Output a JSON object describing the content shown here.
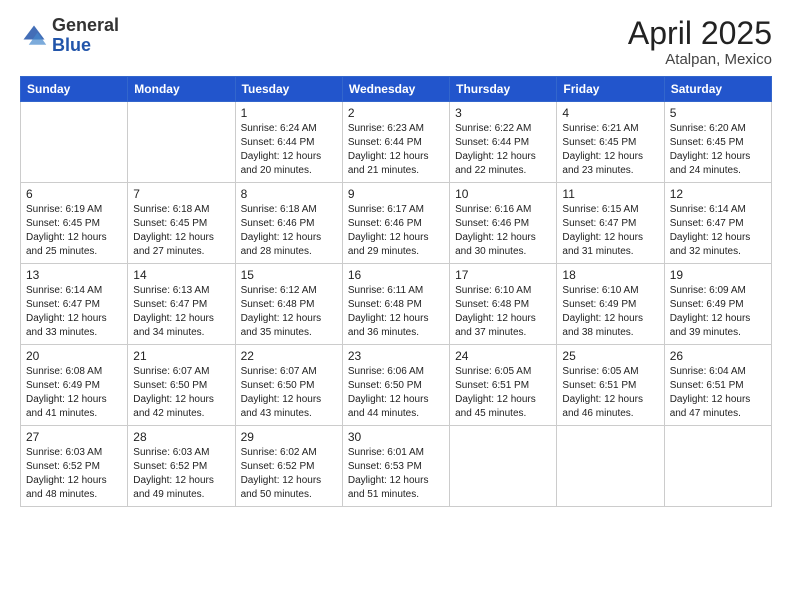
{
  "logo": {
    "general": "General",
    "blue": "Blue"
  },
  "title": {
    "month": "April 2025",
    "location": "Atalpan, Mexico"
  },
  "weekdays": [
    "Sunday",
    "Monday",
    "Tuesday",
    "Wednesday",
    "Thursday",
    "Friday",
    "Saturday"
  ],
  "weeks": [
    [
      {
        "day": null,
        "sunrise": null,
        "sunset": null,
        "daylight": null
      },
      {
        "day": null,
        "sunrise": null,
        "sunset": null,
        "daylight": null
      },
      {
        "day": "1",
        "sunrise": "Sunrise: 6:24 AM",
        "sunset": "Sunset: 6:44 PM",
        "daylight": "Daylight: 12 hours and 20 minutes."
      },
      {
        "day": "2",
        "sunrise": "Sunrise: 6:23 AM",
        "sunset": "Sunset: 6:44 PM",
        "daylight": "Daylight: 12 hours and 21 minutes."
      },
      {
        "day": "3",
        "sunrise": "Sunrise: 6:22 AM",
        "sunset": "Sunset: 6:44 PM",
        "daylight": "Daylight: 12 hours and 22 minutes."
      },
      {
        "day": "4",
        "sunrise": "Sunrise: 6:21 AM",
        "sunset": "Sunset: 6:45 PM",
        "daylight": "Daylight: 12 hours and 23 minutes."
      },
      {
        "day": "5",
        "sunrise": "Sunrise: 6:20 AM",
        "sunset": "Sunset: 6:45 PM",
        "daylight": "Daylight: 12 hours and 24 minutes."
      }
    ],
    [
      {
        "day": "6",
        "sunrise": "Sunrise: 6:19 AM",
        "sunset": "Sunset: 6:45 PM",
        "daylight": "Daylight: 12 hours and 25 minutes."
      },
      {
        "day": "7",
        "sunrise": "Sunrise: 6:18 AM",
        "sunset": "Sunset: 6:45 PM",
        "daylight": "Daylight: 12 hours and 27 minutes."
      },
      {
        "day": "8",
        "sunrise": "Sunrise: 6:18 AM",
        "sunset": "Sunset: 6:46 PM",
        "daylight": "Daylight: 12 hours and 28 minutes."
      },
      {
        "day": "9",
        "sunrise": "Sunrise: 6:17 AM",
        "sunset": "Sunset: 6:46 PM",
        "daylight": "Daylight: 12 hours and 29 minutes."
      },
      {
        "day": "10",
        "sunrise": "Sunrise: 6:16 AM",
        "sunset": "Sunset: 6:46 PM",
        "daylight": "Daylight: 12 hours and 30 minutes."
      },
      {
        "day": "11",
        "sunrise": "Sunrise: 6:15 AM",
        "sunset": "Sunset: 6:47 PM",
        "daylight": "Daylight: 12 hours and 31 minutes."
      },
      {
        "day": "12",
        "sunrise": "Sunrise: 6:14 AM",
        "sunset": "Sunset: 6:47 PM",
        "daylight": "Daylight: 12 hours and 32 minutes."
      }
    ],
    [
      {
        "day": "13",
        "sunrise": "Sunrise: 6:14 AM",
        "sunset": "Sunset: 6:47 PM",
        "daylight": "Daylight: 12 hours and 33 minutes."
      },
      {
        "day": "14",
        "sunrise": "Sunrise: 6:13 AM",
        "sunset": "Sunset: 6:47 PM",
        "daylight": "Daylight: 12 hours and 34 minutes."
      },
      {
        "day": "15",
        "sunrise": "Sunrise: 6:12 AM",
        "sunset": "Sunset: 6:48 PM",
        "daylight": "Daylight: 12 hours and 35 minutes."
      },
      {
        "day": "16",
        "sunrise": "Sunrise: 6:11 AM",
        "sunset": "Sunset: 6:48 PM",
        "daylight": "Daylight: 12 hours and 36 minutes."
      },
      {
        "day": "17",
        "sunrise": "Sunrise: 6:10 AM",
        "sunset": "Sunset: 6:48 PM",
        "daylight": "Daylight: 12 hours and 37 minutes."
      },
      {
        "day": "18",
        "sunrise": "Sunrise: 6:10 AM",
        "sunset": "Sunset: 6:49 PM",
        "daylight": "Daylight: 12 hours and 38 minutes."
      },
      {
        "day": "19",
        "sunrise": "Sunrise: 6:09 AM",
        "sunset": "Sunset: 6:49 PM",
        "daylight": "Daylight: 12 hours and 39 minutes."
      }
    ],
    [
      {
        "day": "20",
        "sunrise": "Sunrise: 6:08 AM",
        "sunset": "Sunset: 6:49 PM",
        "daylight": "Daylight: 12 hours and 41 minutes."
      },
      {
        "day": "21",
        "sunrise": "Sunrise: 6:07 AM",
        "sunset": "Sunset: 6:50 PM",
        "daylight": "Daylight: 12 hours and 42 minutes."
      },
      {
        "day": "22",
        "sunrise": "Sunrise: 6:07 AM",
        "sunset": "Sunset: 6:50 PM",
        "daylight": "Daylight: 12 hours and 43 minutes."
      },
      {
        "day": "23",
        "sunrise": "Sunrise: 6:06 AM",
        "sunset": "Sunset: 6:50 PM",
        "daylight": "Daylight: 12 hours and 44 minutes."
      },
      {
        "day": "24",
        "sunrise": "Sunrise: 6:05 AM",
        "sunset": "Sunset: 6:51 PM",
        "daylight": "Daylight: 12 hours and 45 minutes."
      },
      {
        "day": "25",
        "sunrise": "Sunrise: 6:05 AM",
        "sunset": "Sunset: 6:51 PM",
        "daylight": "Daylight: 12 hours and 46 minutes."
      },
      {
        "day": "26",
        "sunrise": "Sunrise: 6:04 AM",
        "sunset": "Sunset: 6:51 PM",
        "daylight": "Daylight: 12 hours and 47 minutes."
      }
    ],
    [
      {
        "day": "27",
        "sunrise": "Sunrise: 6:03 AM",
        "sunset": "Sunset: 6:52 PM",
        "daylight": "Daylight: 12 hours and 48 minutes."
      },
      {
        "day": "28",
        "sunrise": "Sunrise: 6:03 AM",
        "sunset": "Sunset: 6:52 PM",
        "daylight": "Daylight: 12 hours and 49 minutes."
      },
      {
        "day": "29",
        "sunrise": "Sunrise: 6:02 AM",
        "sunset": "Sunset: 6:52 PM",
        "daylight": "Daylight: 12 hours and 50 minutes."
      },
      {
        "day": "30",
        "sunrise": "Sunrise: 6:01 AM",
        "sunset": "Sunset: 6:53 PM",
        "daylight": "Daylight: 12 hours and 51 minutes."
      },
      {
        "day": null,
        "sunrise": null,
        "sunset": null,
        "daylight": null
      },
      {
        "day": null,
        "sunrise": null,
        "sunset": null,
        "daylight": null
      },
      {
        "day": null,
        "sunrise": null,
        "sunset": null,
        "daylight": null
      }
    ]
  ]
}
